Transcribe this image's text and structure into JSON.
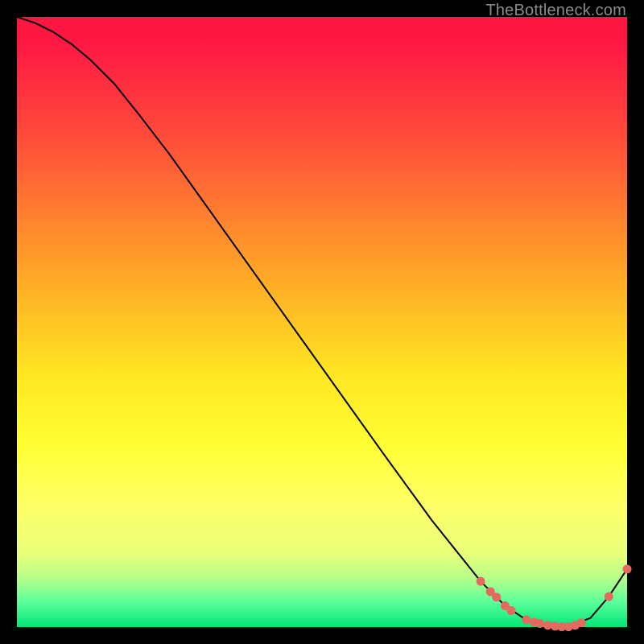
{
  "watermark": "TheBottleneck.com",
  "colors": {
    "curve": "#000000",
    "marker_fill": "#e26a5f",
    "marker_stroke": "#e26a5f"
  },
  "chart_data": {
    "type": "line",
    "title": "",
    "xlabel": "",
    "ylabel": "",
    "xlim": [
      0,
      100
    ],
    "ylim": [
      0,
      100
    ],
    "x": [
      0,
      3,
      6,
      9,
      12,
      16,
      20,
      25,
      30,
      35,
      40,
      45,
      50,
      55,
      60,
      64,
      68,
      72,
      76,
      80,
      83,
      86,
      90,
      94,
      97,
      100
    ],
    "y": [
      100,
      99,
      97.5,
      95.5,
      93,
      89,
      84,
      77.5,
      70.5,
      63.5,
      56.5,
      49.5,
      42.5,
      35.5,
      28.5,
      23,
      17.5,
      12.5,
      7.5,
      3.5,
      1.5,
      0.5,
      0,
      1.5,
      5,
      9.5
    ],
    "series": [
      {
        "name": "curve",
        "x": [
          0,
          3,
          6,
          9,
          12,
          16,
          20,
          25,
          30,
          35,
          40,
          45,
          50,
          55,
          60,
          64,
          68,
          72,
          76,
          80,
          83,
          86,
          90,
          94,
          97,
          100
        ],
        "y": [
          100,
          99,
          97.5,
          95.5,
          93,
          89,
          84,
          77.5,
          70.5,
          63.5,
          56.5,
          49.5,
          42.5,
          35.5,
          28.5,
          23,
          17.5,
          12.5,
          7.5,
          3.5,
          1.5,
          0.5,
          0,
          1.5,
          5,
          9.5
        ]
      }
    ],
    "markers": [
      {
        "x": 76.0,
        "y": 7.5
      },
      {
        "x": 77.6,
        "y": 5.8
      },
      {
        "x": 78.6,
        "y": 4.9
      },
      {
        "x": 80.0,
        "y": 3.5
      },
      {
        "x": 81.0,
        "y": 2.7
      },
      {
        "x": 83.5,
        "y": 1.2
      },
      {
        "x": 84.8,
        "y": 0.8
      },
      {
        "x": 85.7,
        "y": 0.6
      },
      {
        "x": 87.0,
        "y": 0.3
      },
      {
        "x": 88.2,
        "y": 0.15
      },
      {
        "x": 89.3,
        "y": 0.05
      },
      {
        "x": 90.4,
        "y": 0.05
      },
      {
        "x": 91.5,
        "y": 0.3
      },
      {
        "x": 92.5,
        "y": 0.7
      },
      {
        "x": 97.0,
        "y": 5.0
      },
      {
        "x": 100.0,
        "y": 9.5
      }
    ]
  }
}
